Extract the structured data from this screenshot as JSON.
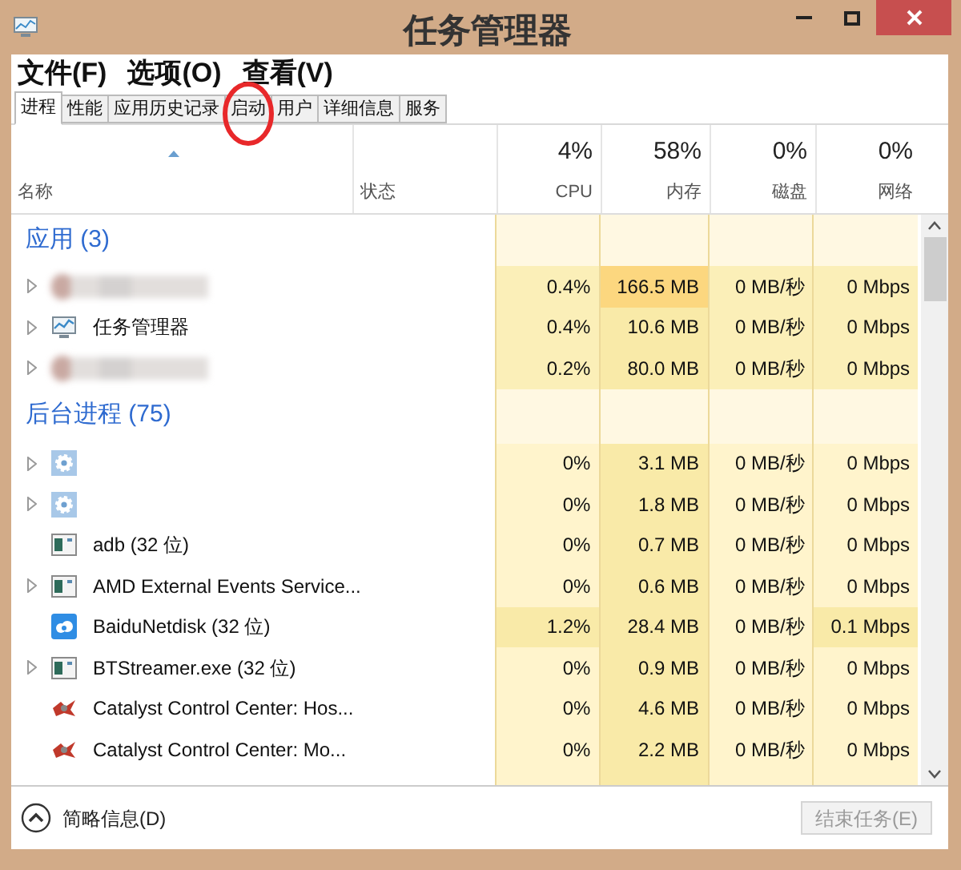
{
  "window": {
    "title": "任务管理器"
  },
  "menu": [
    "文件(F)",
    "选项(O)",
    "查看(V)"
  ],
  "tabs": [
    {
      "label": "进程",
      "selected": true
    },
    {
      "label": "性能",
      "selected": false
    },
    {
      "label": "应用历史记录",
      "selected": false
    },
    {
      "label": "启动",
      "selected": false
    },
    {
      "label": "用户",
      "selected": false
    },
    {
      "label": "详细信息",
      "selected": false
    },
    {
      "label": "服务",
      "selected": false
    }
  ],
  "columns": [
    {
      "label": "名称"
    },
    {
      "label": "状态"
    },
    {
      "total": "4%",
      "label": "CPU"
    },
    {
      "total": "58%",
      "label": "内存"
    },
    {
      "total": "0%",
      "label": "磁盘"
    },
    {
      "total": "0%",
      "label": "网络"
    }
  ],
  "groups": [
    {
      "title": "应用 (3)",
      "rows": [
        {
          "kind": "redacted",
          "has_children": true,
          "cells": [
            {
              "text": "0.4%",
              "color": "#fbefb8"
            },
            {
              "text": "166.5 MB",
              "color": "#fcd77f"
            },
            {
              "text": "0 MB/秒",
              "color": "#fbefb8"
            },
            {
              "text": "0 Mbps",
              "color": "#fbefb8"
            }
          ]
        },
        {
          "kind": "monitor",
          "name": "任务管理器",
          "has_children": true,
          "cells": [
            {
              "text": "0.4%",
              "color": "#fbefb8"
            },
            {
              "text": "10.6 MB",
              "color": "#f9eaa8"
            },
            {
              "text": "0 MB/秒",
              "color": "#fbefb8"
            },
            {
              "text": "0 Mbps",
              "color": "#fbefb8"
            }
          ]
        },
        {
          "kind": "redacted",
          "has_children": true,
          "cells": [
            {
              "text": "0.2%",
              "color": "#fbefb8"
            },
            {
              "text": "80.0 MB",
              "color": "#f9eaa8"
            },
            {
              "text": "0 MB/秒",
              "color": "#fbefb8"
            },
            {
              "text": "0 Mbps",
              "color": "#fbefb8"
            }
          ]
        }
      ]
    },
    {
      "title": "后台进程 (75)",
      "rows": [
        {
          "kind": "gear",
          "has_children": true,
          "cells": [
            {
              "text": "0%",
              "color": "#fff4cc"
            },
            {
              "text": "3.1 MB",
              "color": "#f9eaa8"
            },
            {
              "text": "0 MB/秒",
              "color": "#fff4cc"
            },
            {
              "text": "0 Mbps",
              "color": "#fff4cc"
            }
          ]
        },
        {
          "kind": "gear",
          "has_children": true,
          "cells": [
            {
              "text": "0%",
              "color": "#fff4cc"
            },
            {
              "text": "1.8 MB",
              "color": "#f9eaa8"
            },
            {
              "text": "0 MB/秒",
              "color": "#fff4cc"
            },
            {
              "text": "0 Mbps",
              "color": "#fff4cc"
            }
          ]
        },
        {
          "kind": "program",
          "name": "adb (32 位)",
          "has_children": false,
          "cells": [
            {
              "text": "0%",
              "color": "#fff4cc"
            },
            {
              "text": "0.7 MB",
              "color": "#f9eaa8"
            },
            {
              "text": "0 MB/秒",
              "color": "#fff4cc"
            },
            {
              "text": "0 Mbps",
              "color": "#fff4cc"
            }
          ]
        },
        {
          "kind": "program",
          "name": "AMD External Events Service...",
          "has_children": true,
          "cells": [
            {
              "text": "0%",
              "color": "#fff4cc"
            },
            {
              "text": "0.6 MB",
              "color": "#f9eaa8"
            },
            {
              "text": "0 MB/秒",
              "color": "#fff4cc"
            },
            {
              "text": "0 Mbps",
              "color": "#fff4cc"
            }
          ]
        },
        {
          "kind": "cloud",
          "name": "BaiduNetdisk (32 位)",
          "has_children": false,
          "cells": [
            {
              "text": "1.2%",
              "color": "#f9eaa8"
            },
            {
              "text": "28.4 MB",
              "color": "#f9eaa8"
            },
            {
              "text": "0 MB/秒",
              "color": "#fff4cc"
            },
            {
              "text": "0.1 Mbps",
              "color": "#f9eaa8"
            }
          ]
        },
        {
          "kind": "program",
          "name": "BTStreamer.exe (32 位)",
          "has_children": true,
          "cells": [
            {
              "text": "0%",
              "color": "#fff4cc"
            },
            {
              "text": "0.9 MB",
              "color": "#f9eaa8"
            },
            {
              "text": "0 MB/秒",
              "color": "#fff4cc"
            },
            {
              "text": "0 Mbps",
              "color": "#fff4cc"
            }
          ]
        },
        {
          "kind": "catalyst",
          "name": "Catalyst Control Center: Hos...",
          "has_children": false,
          "cells": [
            {
              "text": "0%",
              "color": "#fff4cc"
            },
            {
              "text": "4.6 MB",
              "color": "#f9eaa8"
            },
            {
              "text": "0 MB/秒",
              "color": "#fff4cc"
            },
            {
              "text": "0 Mbps",
              "color": "#fff4cc"
            }
          ]
        },
        {
          "kind": "catalyst",
          "name": "Catalyst Control Center: Mo...",
          "has_children": false,
          "cells": [
            {
              "text": "0%",
              "color": "#fff4cc"
            },
            {
              "text": "2.2 MB",
              "color": "#f9eaa8"
            },
            {
              "text": "0 MB/秒",
              "color": "#fff4cc"
            },
            {
              "text": "0 Mbps",
              "color": "#fff4cc"
            }
          ]
        }
      ]
    }
  ],
  "footer": {
    "details": "简略信息(D)",
    "end_task": {
      "label": "结束任务(E)",
      "disabled": true
    }
  }
}
